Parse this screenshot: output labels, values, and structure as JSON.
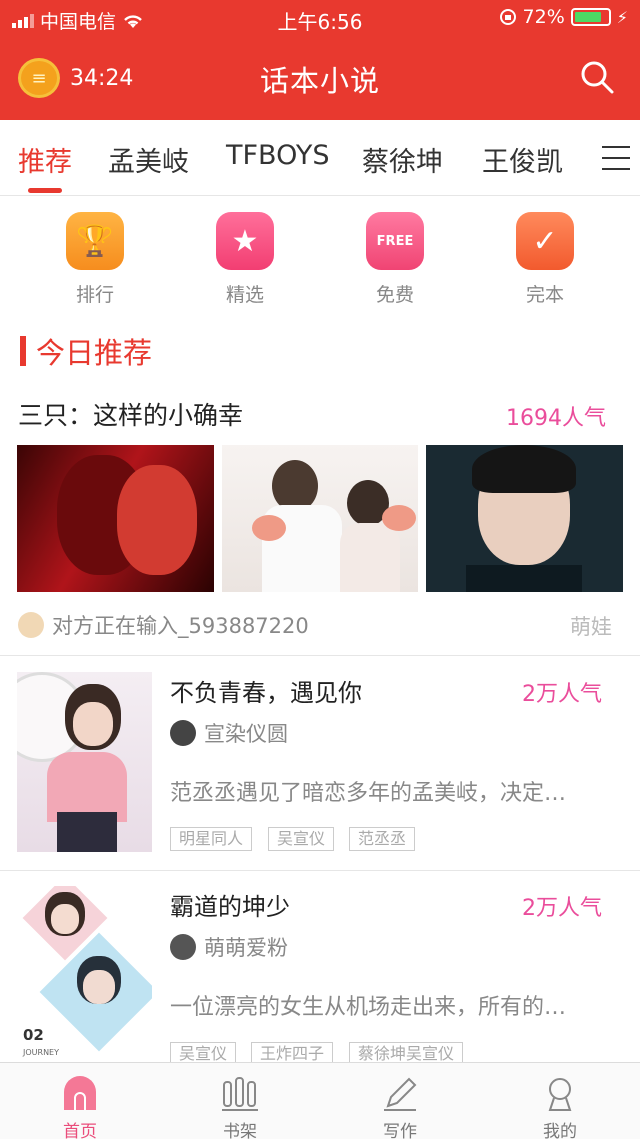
{
  "status_bar": {
    "carrier": "中国电信",
    "time": "上午6:56",
    "battery": "72%"
  },
  "header": {
    "timer": "34:24",
    "title": "话本小说"
  },
  "tabs": [
    "推荐",
    "孟美岐",
    "TFBOYS",
    "蔡徐坤",
    "王俊凯"
  ],
  "categories": [
    {
      "label": "排行",
      "icon": "trophy-icon"
    },
    {
      "label": "精选",
      "icon": "star-icon"
    },
    {
      "label": "免费",
      "icon": "free-tag-icon"
    },
    {
      "label": "完本",
      "icon": "check-book-icon"
    }
  ],
  "section": {
    "title": "今日推荐"
  },
  "featured": {
    "title": "三只：这样的小确幸",
    "popularity": "1694人气",
    "author": "对方正在输入_593887220",
    "right_label": "萌娃"
  },
  "books": [
    {
      "title": "不负青春，遇见你",
      "popularity": "2万人气",
      "author": "宣染仪圆",
      "desc": "范丞丞遇见了暗恋多年的孟美岐，决定…",
      "tags": [
        "明星同人",
        "吴宣仪",
        "范丞丞"
      ]
    },
    {
      "title": "霸道的坤少",
      "popularity": "2万人气",
      "author": "萌萌爱粉",
      "desc": "一位漂亮的女生从机场走出来，所有的…",
      "tags": [
        "吴宣仪",
        "王炸四子",
        "蔡徐坤吴宣仪"
      ],
      "cover_text": "02",
      "cover_subtext": "JOURNEY"
    }
  ],
  "bottom_nav": [
    "首页",
    "书架",
    "写作",
    "我的"
  ],
  "colors": {
    "brand": "#e8392f",
    "popularity": "#ea4d9b",
    "active_nav": "#ea4d7b"
  }
}
